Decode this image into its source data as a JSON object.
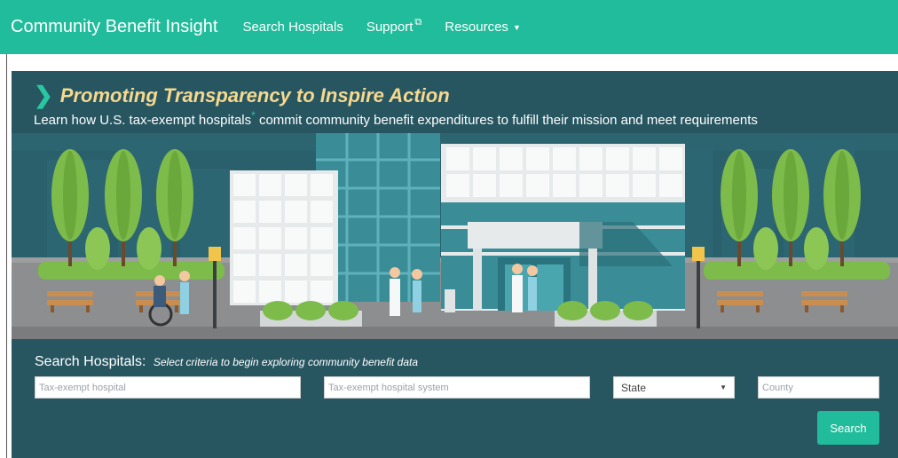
{
  "nav": {
    "brand": "Community Benefit Insight",
    "links": [
      {
        "label": "Search Hospitals"
      },
      {
        "label": "Support",
        "icon": "external-link-icon"
      },
      {
        "label": "Resources",
        "icon": "caret-down-icon"
      }
    ]
  },
  "hero": {
    "tagline": "Promoting Transparency to Inspire Action",
    "subline_pre": "Learn how U.S. tax-exempt hospitals",
    "asterisk": "*",
    "subline_post": " commit community benefit expenditures to fulfill their mission and meet requirements"
  },
  "search": {
    "title": "Search Hospitals:",
    "subtitle": "Select criteria to begin exploring community benefit data",
    "hospital_placeholder": "Tax-exempt hospital",
    "system_placeholder": "Tax-exempt hospital system",
    "state_value": "State",
    "county_placeholder": "County",
    "button_label": "Search"
  },
  "colors": {
    "accent": "#21bc9c",
    "hero_bg": "#26545f",
    "tagline": "#f6d88e"
  }
}
